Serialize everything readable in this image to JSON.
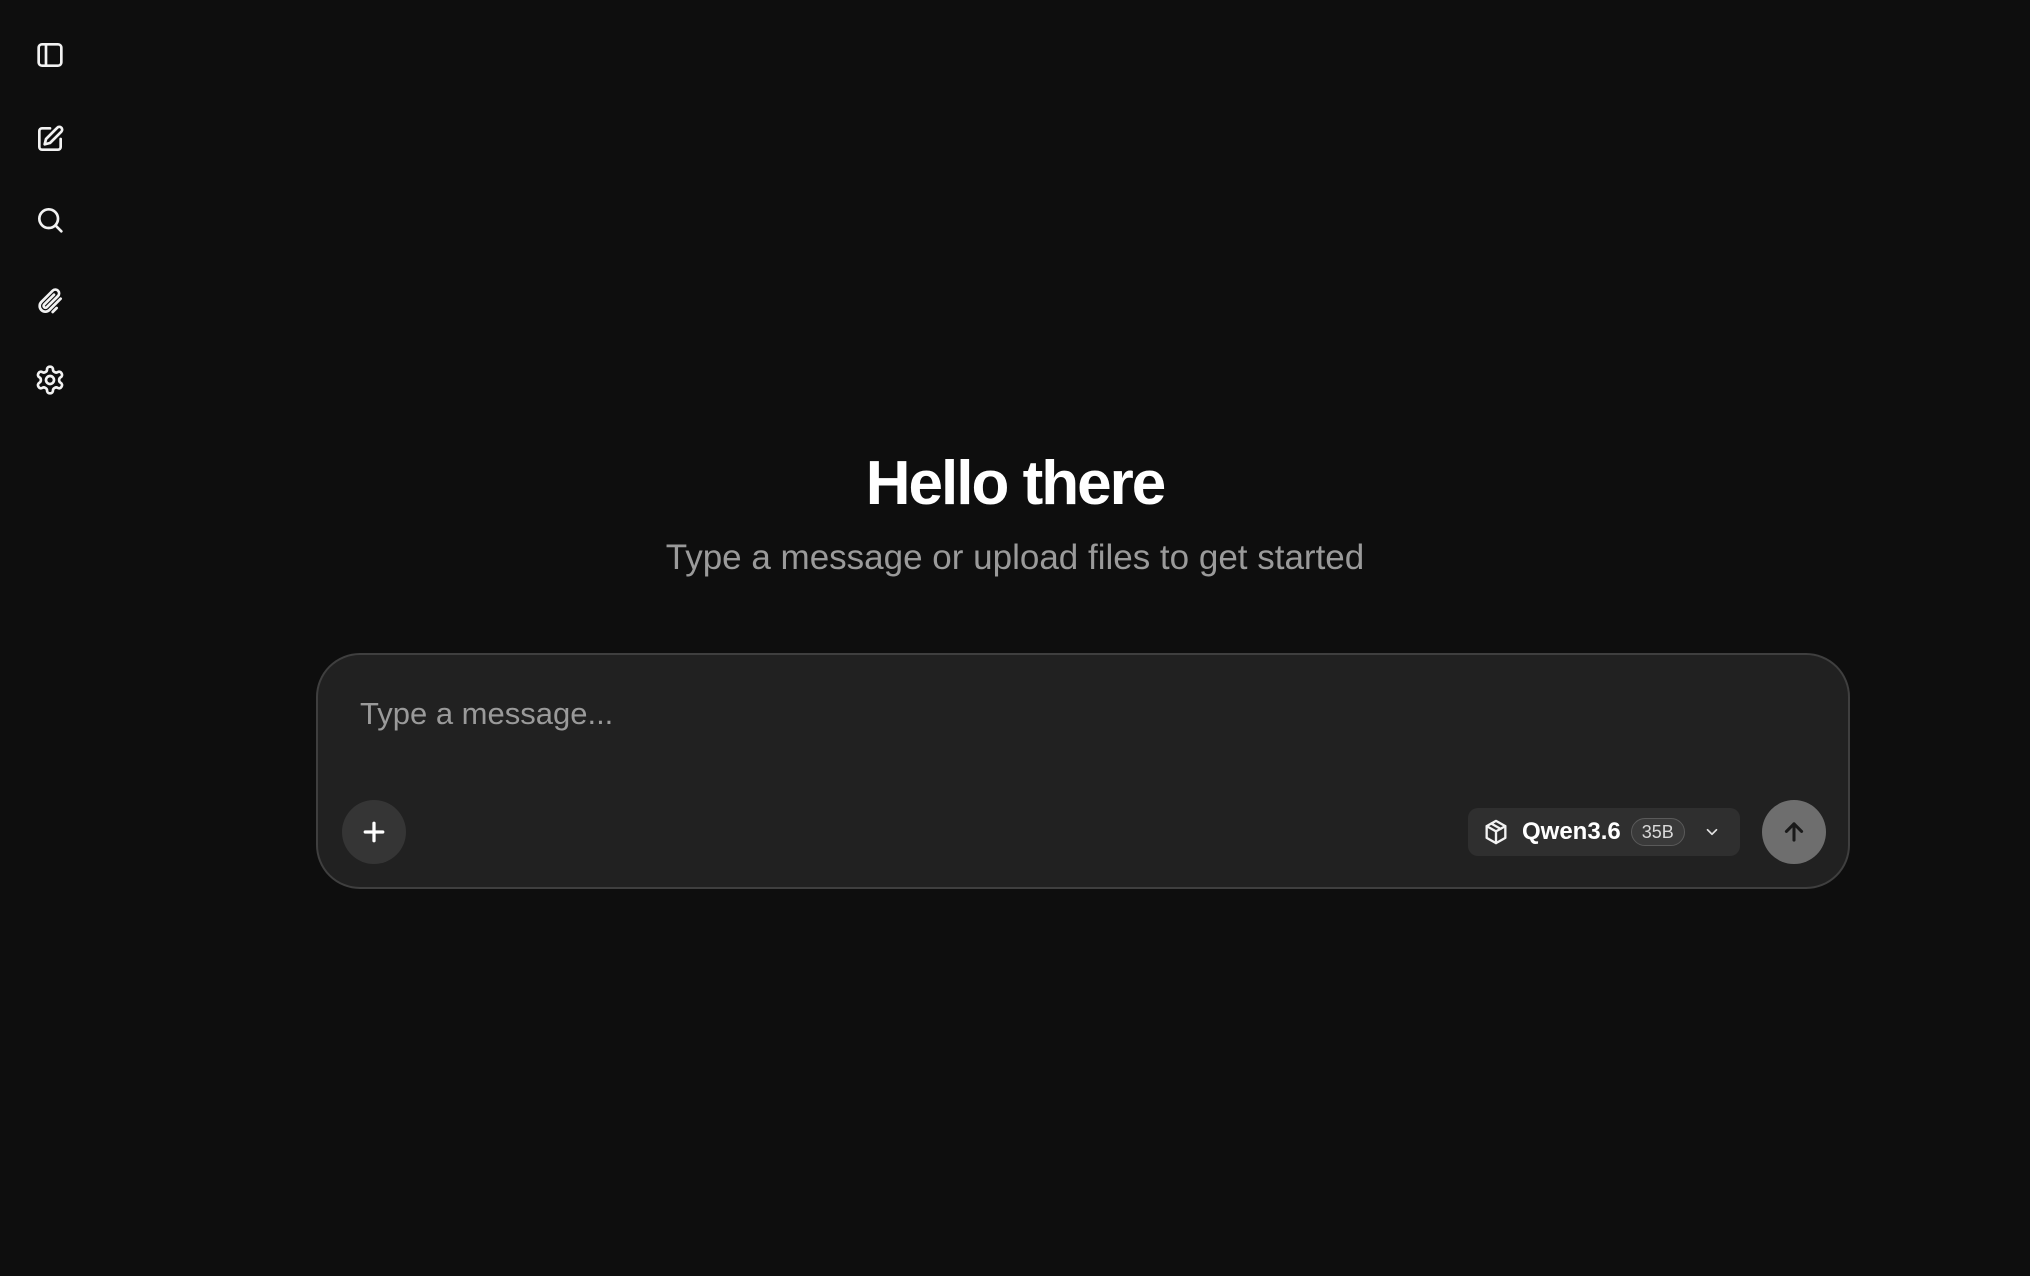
{
  "sidebar": {
    "items": [
      {
        "icon": "sidebar-toggle-icon",
        "label": "Toggle sidebar"
      },
      {
        "icon": "new-chat-icon",
        "label": "New chat"
      },
      {
        "icon": "search-icon",
        "label": "Search"
      },
      {
        "icon": "paperclip-icon",
        "label": "Files"
      },
      {
        "icon": "gear-icon",
        "label": "Settings"
      }
    ]
  },
  "main": {
    "title": "Hello there",
    "subtitle": "Type a message or upload files to get started"
  },
  "composer": {
    "placeholder": "Type a message...",
    "value": "",
    "add_icon": "plus-icon",
    "send_icon": "arrow-up-icon",
    "model": {
      "name": "Qwen3.6",
      "size_badge": "35B",
      "icon": "cube-icon",
      "dropdown_icon": "chevron-down-icon"
    }
  },
  "colors": {
    "background": "#0e0e0e",
    "composer_bg": "#212121",
    "composer_border": "#3f3f3f",
    "subtitle": "#9a9a9a",
    "send_button": "#6e6e6e"
  }
}
